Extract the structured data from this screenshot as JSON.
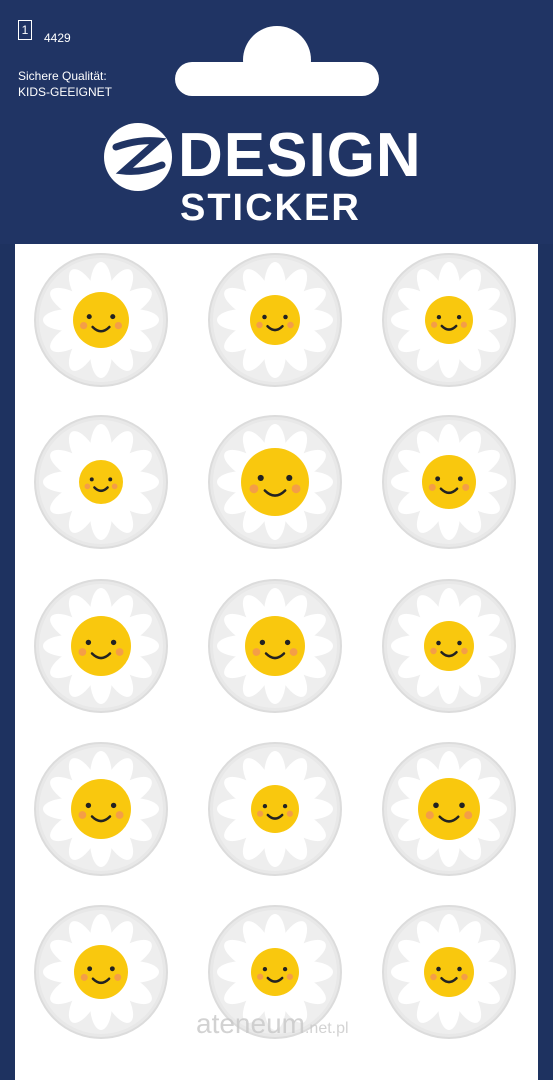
{
  "header": {
    "count": "1",
    "article_number": "4429",
    "quality_line1": "Sichere Qualität:",
    "quality_line2": "KIDS-GEEIGNET",
    "brand_main": "DESIGN",
    "brand_sub": "STICKER"
  },
  "colors": {
    "navy": "#203464",
    "smiley_yellow": "#f9c80e",
    "blush": "#f28b60",
    "daisy_white": "#ffffff"
  },
  "stickers": [
    {
      "icon": "sleepy-smiley-icon"
    },
    {
      "icon": "shy-smiley-icon"
    },
    {
      "icon": "grinning-smiley-icon"
    },
    {
      "icon": "sunglasses-smiley-icon"
    },
    {
      "icon": "lashes-smiley-icon"
    },
    {
      "icon": "big-smile-smiley-icon"
    },
    {
      "icon": "blushing-smiley-icon"
    },
    {
      "icon": "simple-smile-smiley-icon"
    },
    {
      "icon": "googly-eyes-smiley-icon"
    },
    {
      "icon": "sideeye-smiley-icon"
    },
    {
      "icon": "cute-smiley-icon"
    },
    {
      "icon": "happy-closed-eyes-smiley-icon"
    },
    {
      "icon": "calm-smiley-icon"
    },
    {
      "icon": "round-glasses-smiley-icon"
    },
    {
      "icon": "wide-eyes-smiley-icon"
    }
  ],
  "watermark": {
    "main": "ateneum",
    "suffix": ".net.pl"
  }
}
